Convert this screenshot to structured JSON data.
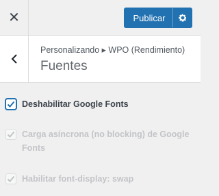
{
  "topbar": {
    "close_glyph": "✕",
    "publish_label": "Publicar",
    "settings_icon": "gear-icon"
  },
  "section": {
    "breadcrumb": "Personalizando ▸ WPO (Rendimiento)",
    "title": "Fuentes",
    "back_icon": "chevron-left-icon"
  },
  "options": [
    {
      "label": "Deshabilitar Google Fonts",
      "checked": true,
      "disabled": false
    },
    {
      "label_line1": "Carga asíncrona (no blocking) de Google",
      "label_line2": "Fonts",
      "checked": true,
      "disabled": true
    },
    {
      "label": "Habilitar font-display: swap",
      "checked": true,
      "disabled": true
    }
  ],
  "colors": {
    "accent": "#2271b1",
    "disabled_text": "#c3c4c7",
    "panel_bg": "#f0f0f1"
  }
}
